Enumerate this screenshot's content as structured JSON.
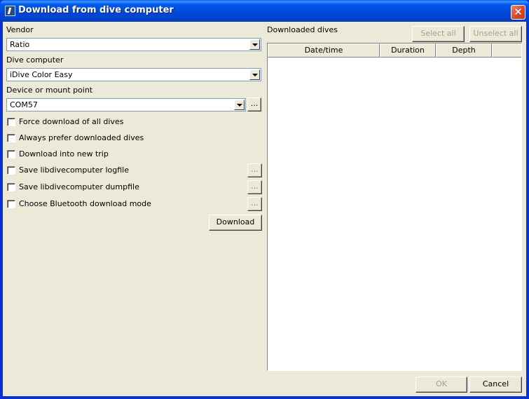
{
  "window": {
    "title": "Download from dive computer",
    "close_label": "✕"
  },
  "left": {
    "vendor_label": "Vendor",
    "vendor_value": "Ratio",
    "dive_computer_label": "Dive computer",
    "dive_computer_value": "iDive Color Easy",
    "device_label": "Device or mount point",
    "device_value": "COM57",
    "browse_label": "...",
    "options": [
      {
        "label": "Force download of all dives",
        "checked": false
      },
      {
        "label": "Always prefer downloaded dives",
        "checked": false
      },
      {
        "label": "Download into new trip",
        "checked": false
      },
      {
        "label": "Save libdivecomputer logfile",
        "checked": false,
        "has_browse": true
      },
      {
        "label": "Save libdivecomputer dumpfile",
        "checked": false,
        "has_browse": true
      },
      {
        "label": "Choose Bluetooth download mode",
        "checked": false,
        "has_browse": true
      }
    ],
    "download_label": "Download"
  },
  "right": {
    "title": "Downloaded dives",
    "select_all_label": "Select all",
    "unselect_all_label": "Unselect all",
    "columns": [
      "Date/time",
      "Duration",
      "Depth"
    ],
    "rows": []
  },
  "footer": {
    "ok_label": "OK",
    "cancel_label": "Cancel"
  }
}
